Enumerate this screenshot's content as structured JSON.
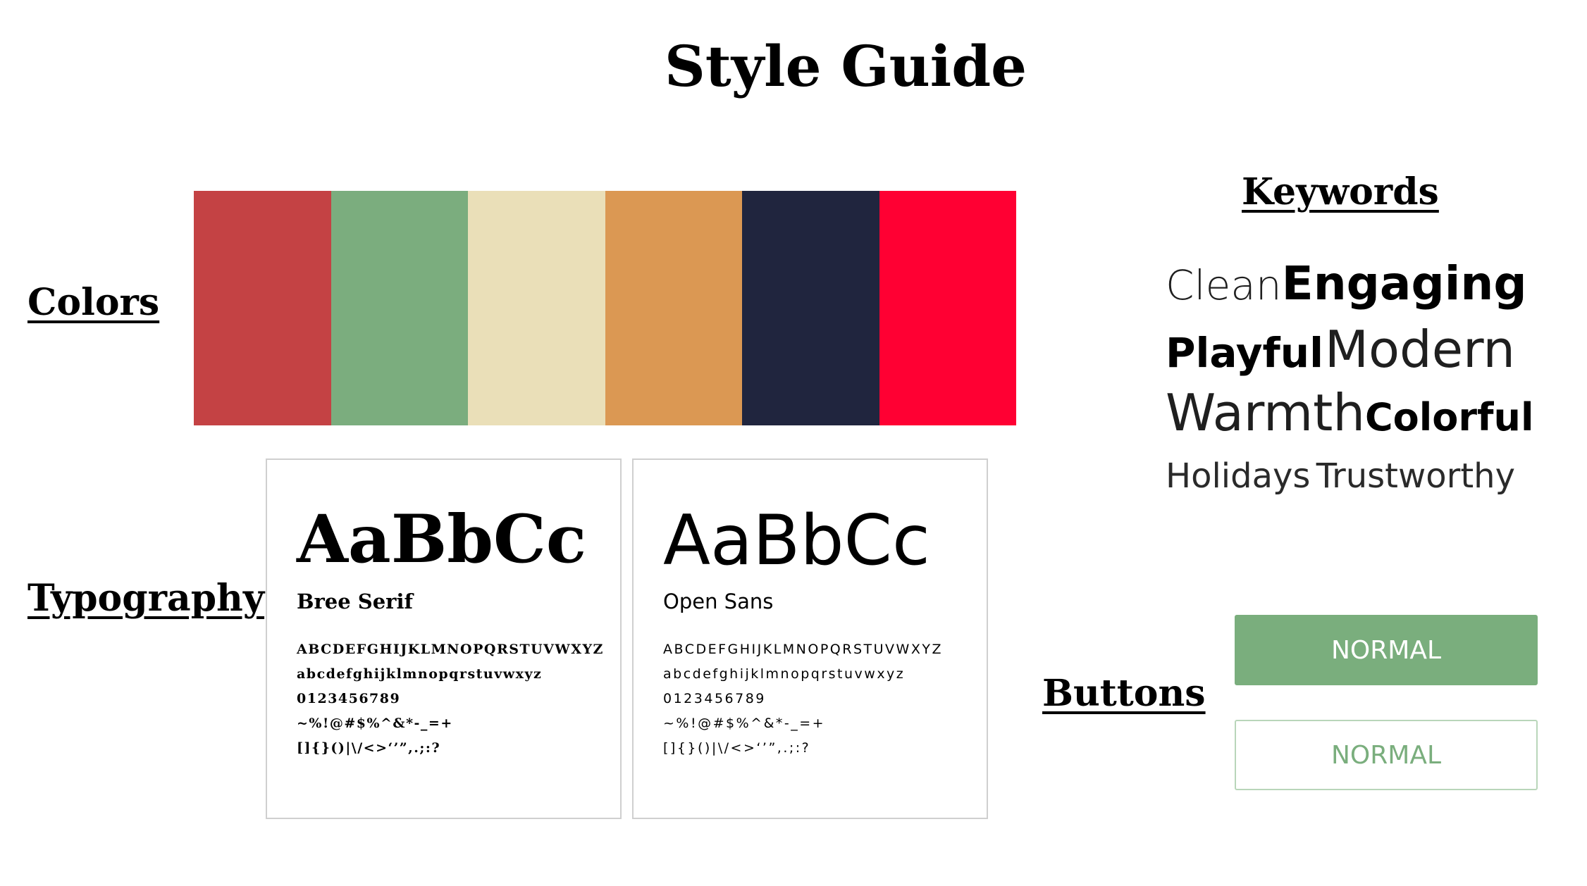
{
  "title": "Style Guide",
  "sections": {
    "colors": "Colors",
    "typography": "Typography",
    "buttons": "Buttons",
    "keywords": "Keywords"
  },
  "palette": [
    "#C44244",
    "#7BAD7E",
    "#EADFB8",
    "#DB9853",
    "#20253E",
    "#FF0033"
  ],
  "fonts": [
    {
      "sample": "AaBbCc",
      "name": "Bree Serif",
      "uppercase": "ABCDEFGHIJKLMNOPQRSTUVWXYZ",
      "lowercase": "abcdefghijklmnopqrstuvwxyz",
      "digits": "0123456789",
      "symbols1": "~%!@#$%^&*-_=+",
      "symbols2": "[]{}()|\\/<>‘’”,.;:?"
    },
    {
      "sample": "AaBbCc",
      "name": "Open Sans",
      "uppercase": "ABCDEFGHIJKLMNOPQRSTUVWXYZ",
      "lowercase": "abcdefghijklmnopqrstuvwxyz",
      "digits": "0123456789",
      "symbols1": "~%!@#$%^&*-_=+",
      "symbols2": "[]{}()|\\/<>‘’”,.;:?"
    }
  ],
  "keywords": [
    "Clean",
    "Engaging",
    "Playful",
    "Modern",
    "Warmth",
    "Colorful",
    "Holidays",
    "Trustworthy"
  ],
  "buttons": {
    "primary_label": "NORMAL",
    "secondary_label": "NORMAL",
    "accent_color": "#7BAD7E"
  }
}
